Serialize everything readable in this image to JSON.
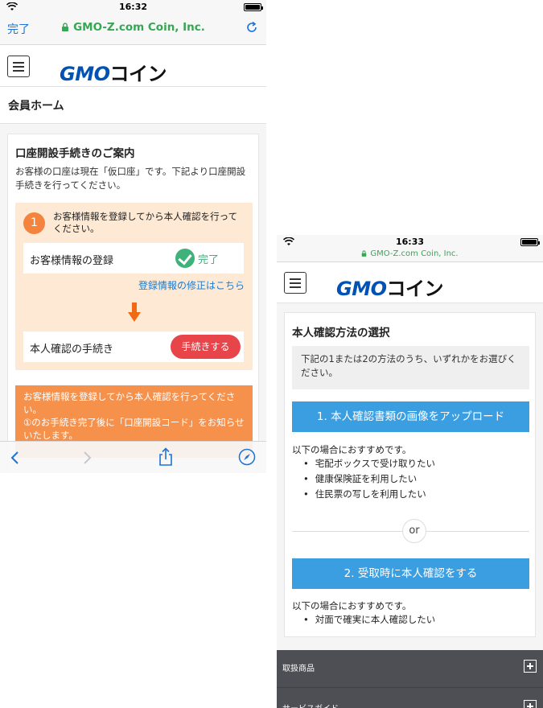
{
  "left": {
    "status": {
      "time": "16:32"
    },
    "browser": {
      "done": "完了",
      "url": "GMO-Z.com Coin, Inc."
    },
    "logo": {
      "part1": "GMO",
      "part2": "コイン"
    },
    "page_title": "会員ホーム",
    "card": {
      "title": "口座開設手続きのご案内",
      "intro": "お客様の口座は現在「仮口座」です。下記より口座開設手続きを行ってください。",
      "step_number": "1",
      "step_text": "お客様情報を登録してから本人確認を行ってください。",
      "reg_label": "お客様情報の登録",
      "reg_status": "完了",
      "edit_link": "登録情報の修正はこちら",
      "kyc_label": "本人確認の手続き",
      "kyc_button": "手続きする",
      "notice_line1": "お客様情報を登録してから本人確認を行ってください。",
      "notice_line2": "①のお手続き完了後に「口座開設コード」をお知らせいたします。"
    },
    "toolbar": [
      "back-icon",
      "forward-icon",
      "share-icon",
      "compass-icon"
    ]
  },
  "right": {
    "status": {
      "time": "16:33"
    },
    "browser": {
      "url": "GMO-Z.com Coin, Inc."
    },
    "logo": {
      "part1": "GMO",
      "part2": "コイン"
    },
    "card": {
      "title": "本人確認方法の選択",
      "note": "下記の1または2の方法のうち、いずれかをお選びください。",
      "option1": "1. 本人確認書類の画像をアップロード",
      "rec1_title": "以下の場合におすすめです。",
      "rec1_items": [
        "宅配ボックスで受け取りたい",
        "健康保険証を利用したい",
        "住民票の写しを利用したい"
      ],
      "or": "or",
      "option2": "2. 受取時に本人確認をする",
      "rec2_title": "以下の場合におすすめです。",
      "rec2_items": [
        "対面で確実に本人確認したい"
      ]
    },
    "footer": {
      "item1": "取扱商品",
      "item2": "サービスガイド"
    }
  },
  "colors": {
    "brand_blue": "#0052b4",
    "link": "#1a7bd0",
    "success": "#3fb27a",
    "danger": "#e8454b",
    "orange": "#f3833d",
    "button_blue": "#3b9ee0"
  }
}
